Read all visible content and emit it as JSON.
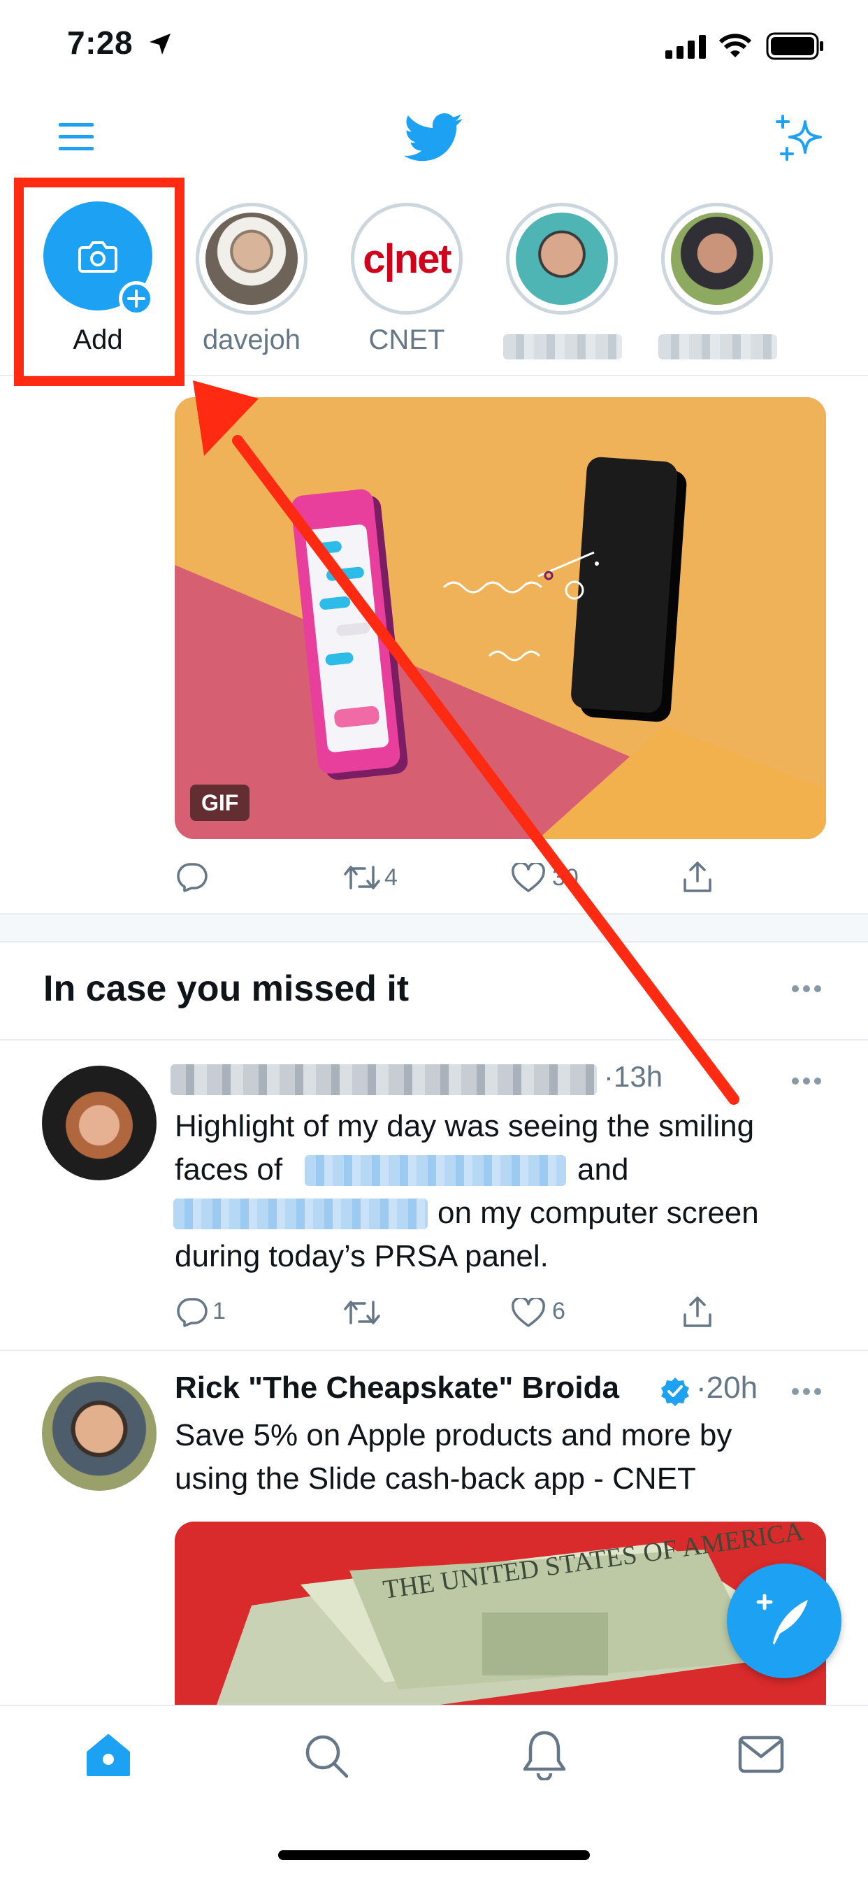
{
  "status_bar": {
    "time": "7:28"
  },
  "fleets": [
    {
      "label": "Add"
    },
    {
      "label": "davejoh"
    },
    {
      "label": "CNET",
      "logo_text": "c|net"
    },
    {
      "label": ""
    },
    {
      "label": ""
    }
  ],
  "tweet1": {
    "media_badge": "GIF",
    "retweets": "4",
    "likes": "30"
  },
  "section": {
    "title": "In case you missed it"
  },
  "tweet2": {
    "time": "·13h",
    "lines": [
      "Highlight of my day was seeing the smiling",
      "faces of",
      "and",
      "on my computer screen",
      "during today’s PRSA panel."
    ],
    "replies": "1",
    "likes": "6"
  },
  "tweet3": {
    "author": "Rick \"The Cheapskate\" Broida",
    "time": "·20h",
    "lines": [
      "Save 5% on Apple products and more by",
      "using the Slide cash-back app - CNET"
    ]
  },
  "colors": {
    "brand": "#1da1f2",
    "annotation_red": "#ff2a12",
    "text": "#0f1419",
    "muted": "#657786"
  },
  "icons": [
    "hamburger-icon",
    "twitter-bird-icon",
    "sparkle-icon",
    "camera-icon",
    "reply-icon",
    "retweet-icon",
    "like-icon",
    "share-icon",
    "more-icon",
    "verified-icon",
    "compose-icon",
    "home-icon",
    "search-icon",
    "notifications-icon",
    "messages-icon"
  ]
}
